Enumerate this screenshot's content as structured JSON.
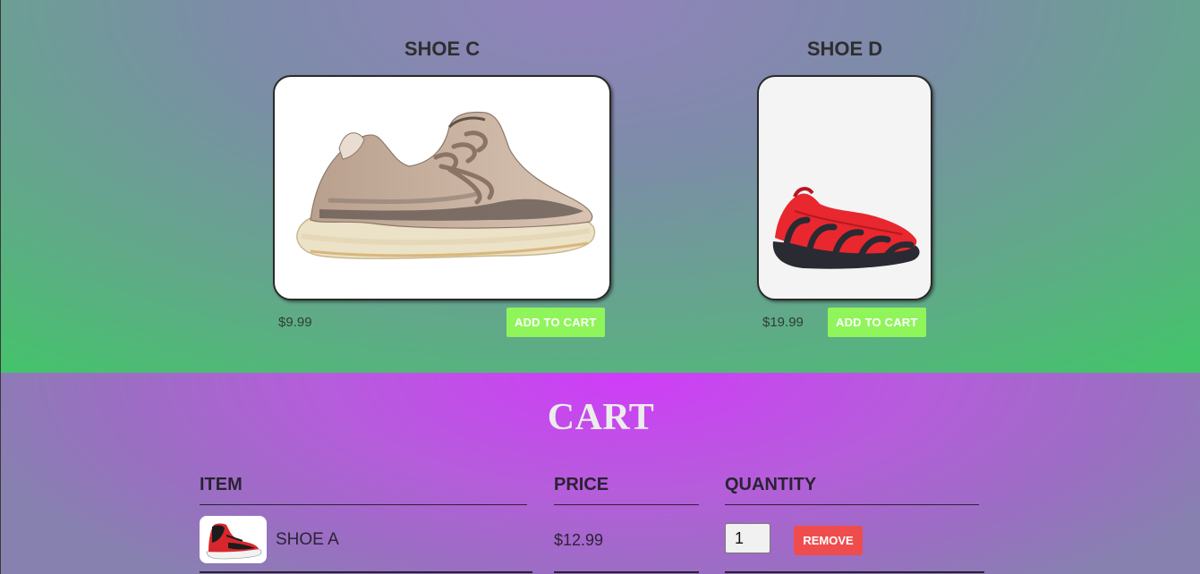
{
  "products": [
    {
      "name": "SHOE C",
      "price": "$9.99",
      "button": "ADD TO CART",
      "image_icon": "shoe-yeezy-image"
    },
    {
      "name": "SHOE D",
      "price": "$19.99",
      "button": "ADD TO CART",
      "image_icon": "shoe-red-runner-image"
    }
  ],
  "cart": {
    "title": "CART",
    "headers": {
      "item": "ITEM",
      "price": "PRICE",
      "quantity": "QUANTITY"
    },
    "rows": [
      {
        "name": "SHOE A",
        "price": "$12.99",
        "quantity": "1",
        "remove_label": "REMOVE",
        "image_icon": "shoe-jordan-image"
      }
    ]
  },
  "colors": {
    "add_button": "#8ff55a",
    "remove_button": "#ef4d4d",
    "cart_title": "#ececec"
  }
}
